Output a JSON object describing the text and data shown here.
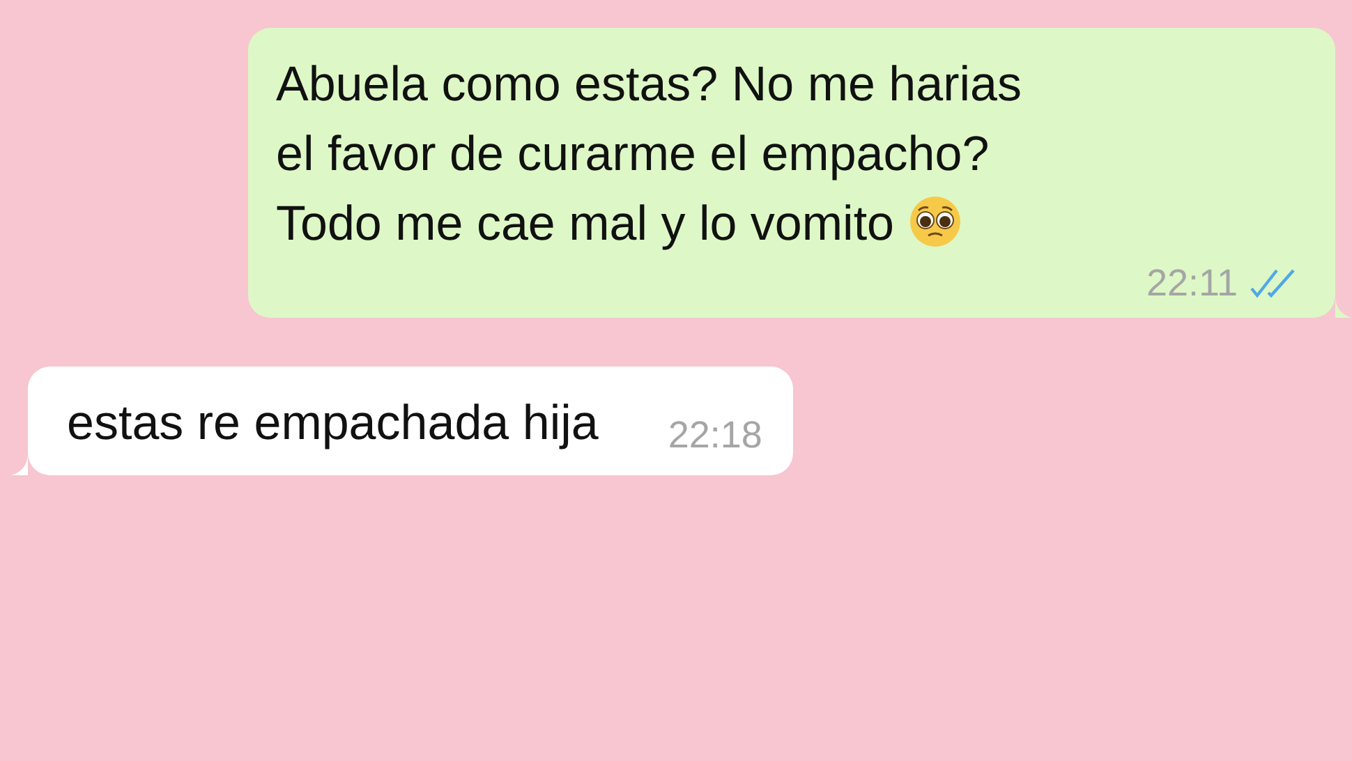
{
  "messages": [
    {
      "kind": "outgoing",
      "text": "Abuela como estas? No me harias\nel favor de curarme el empacho?\nTodo me cae mal y lo vomito",
      "has_emoji": true,
      "time": "22:11",
      "read": true
    },
    {
      "kind": "incoming",
      "text": "estas re empachada hija",
      "time": "22:18"
    }
  ]
}
